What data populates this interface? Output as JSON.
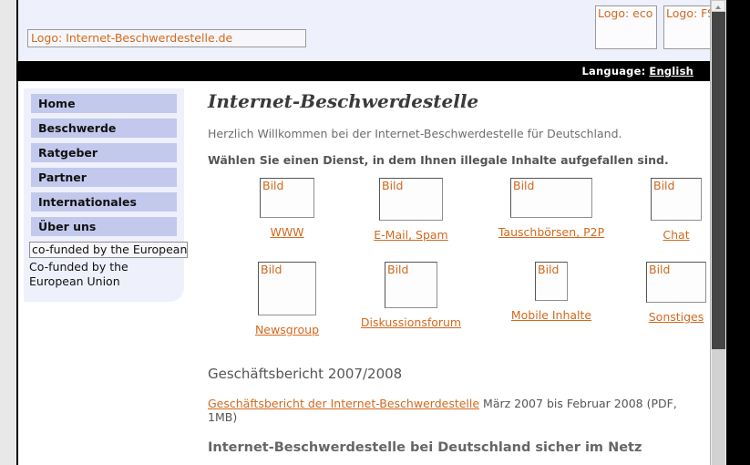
{
  "browser": {
    "scrollbar": {
      "up_arrow_icon": "triangle-up-icon",
      "thumb_position_pct": 0
    }
  },
  "header": {
    "logo_main": "Logo: Internet-Beschwerdestelle.de",
    "logo_eco": "Logo: eco",
    "logo_fsm": "Logo: FSM"
  },
  "language_bar": {
    "label": "Language:",
    "value": "English"
  },
  "sidebar": {
    "items": [
      {
        "label": "Home"
      },
      {
        "label": "Beschwerde"
      },
      {
        "label": "Ratgeber"
      },
      {
        "label": "Partner"
      },
      {
        "label": "Internationales"
      },
      {
        "label": "Über uns"
      }
    ],
    "eu_image_alt": "co-funded by the European Union",
    "eu_caption": "Co-funded by the European Union"
  },
  "main": {
    "title": "Internet-Beschwerdestelle",
    "intro": "Herzlich Willkommen bei der Internet-Beschwerdestelle für Deutschland.",
    "prompt": "Wählen Sie einen Dienst, in dem Ihnen illegale Inhalte aufgefallen sind.",
    "services_row1": [
      {
        "image_alt": "Bild",
        "label": "WWW"
      },
      {
        "image_alt": "Bild",
        "label": "E-Mail, Spam"
      },
      {
        "image_alt": "Bild",
        "label": "Tauschbörsen, P2P"
      },
      {
        "image_alt": "Bild",
        "label": "Chat"
      }
    ],
    "services_row2": [
      {
        "image_alt": "Bild",
        "label": "Newsgroup"
      },
      {
        "image_alt": "Bild",
        "label": "Diskussionsforum"
      },
      {
        "image_alt": "Bild",
        "label": "Mobile Inhalte"
      },
      {
        "image_alt": "Bild",
        "label": "Sonstiges"
      }
    ],
    "report": {
      "heading": "Geschäftsbericht 2007/2008",
      "link": "Geschäftsbericht der Internet-Beschwerdestelle",
      "detail": " März 2007 bis Februar 2008 (PDF, 1MB)",
      "subheading": "Internet-Beschwerdestelle bei Deutschland sicher im Netz"
    }
  },
  "colors": {
    "accent_link": "#d2691e",
    "nav_item_bg": "#c3c9ec",
    "panel_bg": "#eef0fb",
    "langbar_bg": "#000000"
  }
}
